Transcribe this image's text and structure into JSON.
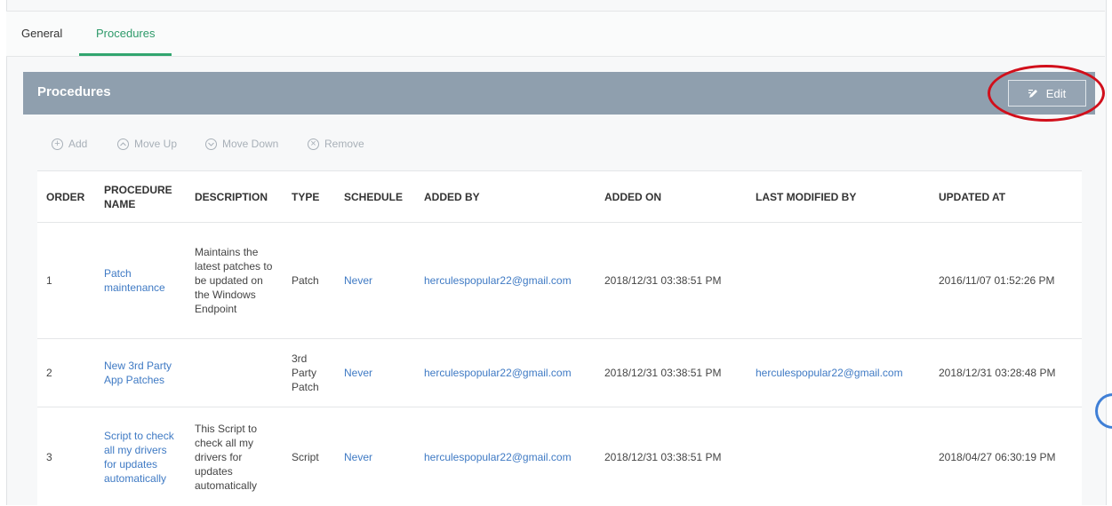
{
  "tabs": [
    {
      "label": "General",
      "active": false
    },
    {
      "label": "Procedures",
      "active": true
    }
  ],
  "panel": {
    "title": "Procedures",
    "edit_label": "Edit"
  },
  "toolbar": {
    "add": "Add",
    "move_up": "Move Up",
    "move_down": "Move Down",
    "remove": "Remove"
  },
  "table": {
    "headers": [
      "ORDER",
      "PROCEDURE NAME",
      "DESCRIPTION",
      "TYPE",
      "SCHEDULE",
      "ADDED BY",
      "ADDED ON",
      "LAST MODIFIED BY",
      "UPDATED AT"
    ],
    "rows": [
      {
        "order": "1",
        "name": "Patch maintenance",
        "description": "Maintains the latest patches to be updated on the Windows Endpoint",
        "type": "Patch",
        "schedule": "Never",
        "added_by": "herculespopular22@gmail.com",
        "added_on": "2018/12/31 03:38:51 PM",
        "last_modified_by": "",
        "updated_at": "2016/11/07 01:52:26 PM"
      },
      {
        "order": "2",
        "name": "New 3rd Party App Patches",
        "description": "",
        "type": "3rd Party Patch",
        "schedule": "Never",
        "added_by": "herculespopular22@gmail.com",
        "added_on": "2018/12/31 03:38:51 PM",
        "last_modified_by": "herculespopular22@gmail.com",
        "updated_at": "2018/12/31 03:28:48 PM"
      },
      {
        "order": "3",
        "name": "Script to check all my drivers for updates automatically",
        "description": "This Script to check all my drivers for updates automatically",
        "type": "Script",
        "schedule": "Never",
        "added_by": "herculespopular22@gmail.com",
        "added_on": "2018/12/31 03:38:51 PM",
        "last_modified_by": "",
        "updated_at": "2018/04/27 06:30:19 PM"
      }
    ]
  },
  "colors": {
    "header_bg": "#8f9fae",
    "accent_green": "#31a56f",
    "link_blue": "#3f7ac4",
    "highlight_red": "#d10f1b"
  }
}
